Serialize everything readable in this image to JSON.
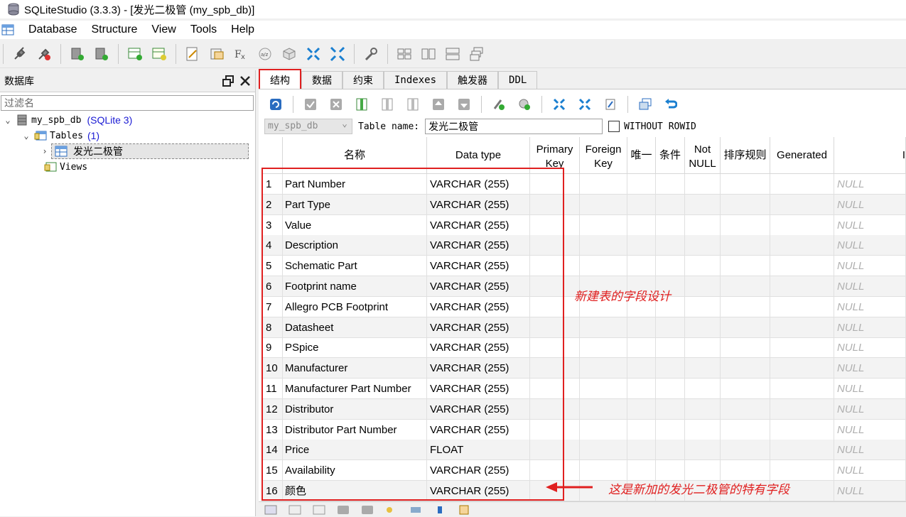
{
  "window": {
    "title": "SQLiteStudio (3.3.3) - [发光二极管 (my_spb_db)]"
  },
  "menu": [
    "Database",
    "Structure",
    "View",
    "Tools",
    "Help"
  ],
  "database_panel": {
    "title": "数据库",
    "filter_placeholder": "过滤名",
    "db_name": "my_spb_db",
    "db_type": "(SQLite 3)",
    "tables_label": "Tables",
    "tables_count": "(1)",
    "table_name": "发光二极管",
    "views_label": "Views"
  },
  "tabs": [
    "结构",
    "数据",
    "约束",
    "Indexes",
    "触发器",
    "DDL"
  ],
  "editor": {
    "db_combo": "my_spb_db",
    "table_name_label": "Table name:",
    "table_name_value": "发光二极管",
    "without_rowid_label": "WITHOUT ROWID"
  },
  "columns": {
    "name": "名称",
    "type": "Data type",
    "pk": "Primary Key",
    "fk": "Foreign Key",
    "unique": "唯一",
    "check": "条件",
    "notnull": "Not NULL",
    "collate": "排序规则",
    "generated": "Generated",
    "default_partial": "I"
  },
  "rows": [
    {
      "n": "1",
      "name": "Part Number",
      "type": "VARCHAR (255)",
      "default": "NULL"
    },
    {
      "n": "2",
      "name": "Part Type",
      "type": "VARCHAR (255)",
      "default": "NULL"
    },
    {
      "n": "3",
      "name": "Value",
      "type": "VARCHAR (255)",
      "default": "NULL"
    },
    {
      "n": "4",
      "name": "Description",
      "type": "VARCHAR (255)",
      "default": "NULL"
    },
    {
      "n": "5",
      "name": "Schematic Part",
      "type": "VARCHAR (255)",
      "default": "NULL"
    },
    {
      "n": "6",
      "name": "Footprint name",
      "type": "VARCHAR (255)",
      "default": "NULL"
    },
    {
      "n": "7",
      "name": "Allegro PCB Footprint",
      "type": "VARCHAR (255)",
      "default": "NULL"
    },
    {
      "n": "8",
      "name": "Datasheet",
      "type": "VARCHAR (255)",
      "default": "NULL"
    },
    {
      "n": "9",
      "name": "PSpice",
      "type": "VARCHAR (255)",
      "default": "NULL"
    },
    {
      "n": "10",
      "name": "Manufacturer",
      "type": "VARCHAR (255)",
      "default": "NULL"
    },
    {
      "n": "11",
      "name": "Manufacturer Part Number",
      "type": "VARCHAR (255)",
      "default": "NULL"
    },
    {
      "n": "12",
      "name": "Distributor",
      "type": "VARCHAR (255)",
      "default": "NULL"
    },
    {
      "n": "13",
      "name": "Distributor Part Number",
      "type": "VARCHAR (255)",
      "default": "NULL"
    },
    {
      "n": "14",
      "name": "Price",
      "type": "FLOAT",
      "default": "NULL"
    },
    {
      "n": "15",
      "name": "Availability",
      "type": "VARCHAR (255)",
      "default": "NULL"
    },
    {
      "n": "16",
      "name": "颜色",
      "type": "VARCHAR (255)",
      "default": "NULL"
    }
  ],
  "annotations": {
    "fields_note": "新建表的字段设计",
    "special_note": "这是新加的发光二极管的特有字段"
  },
  "colors": {
    "accent_red": "#e02020",
    "link_blue": "#1a1ad4"
  }
}
